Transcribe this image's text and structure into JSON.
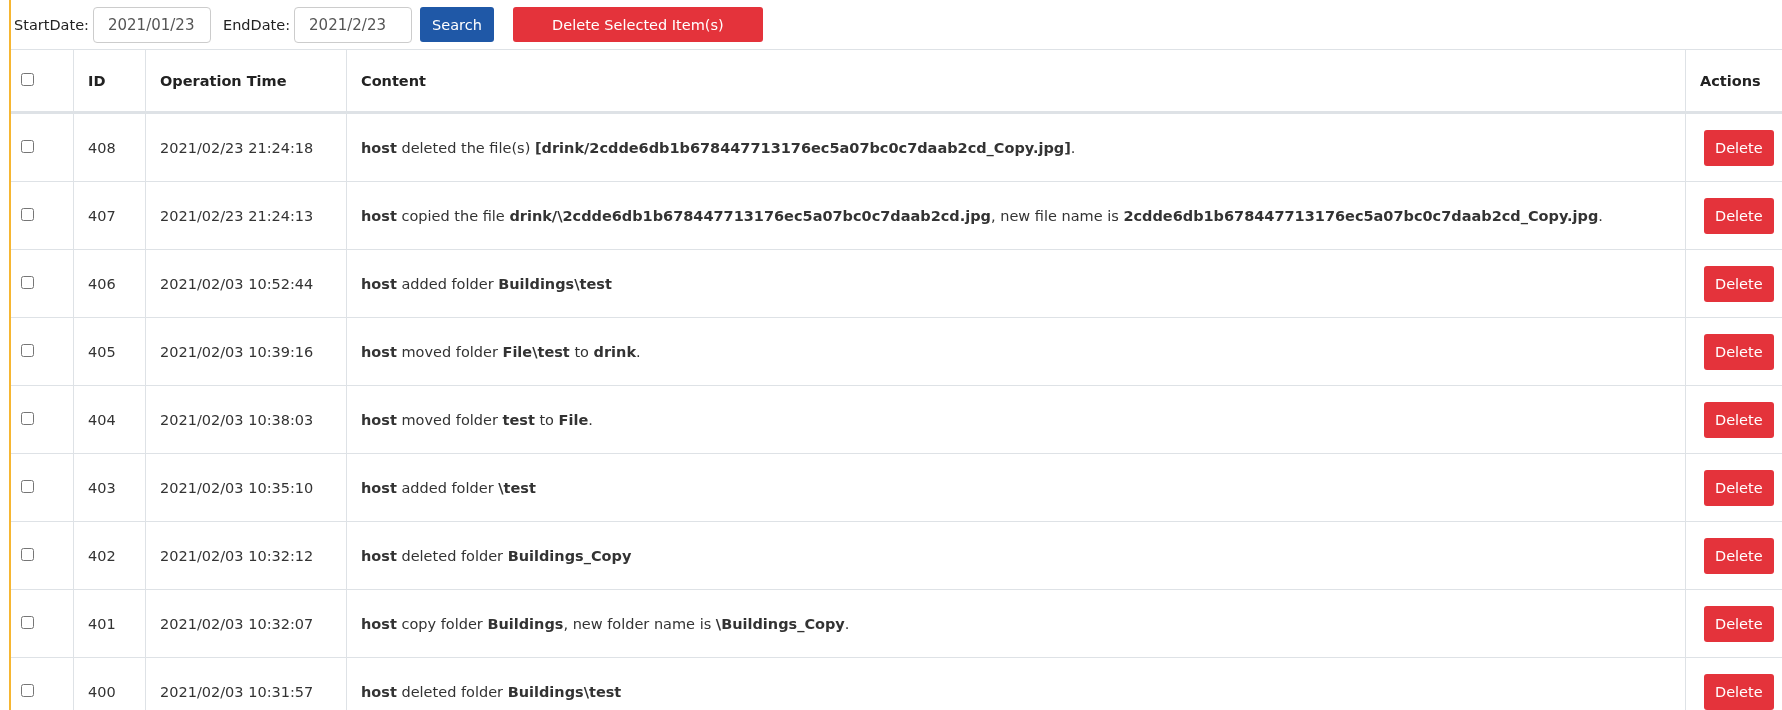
{
  "filter": {
    "start_label": "StartDate:",
    "start_value": "2021/01/23",
    "end_label": "EndDate:",
    "end_value": "2021/2/23",
    "search_button": "Search",
    "delete_selected_button": "Delete Selected Item(s)"
  },
  "table": {
    "select_all_checked": false,
    "columns": [
      "ID",
      "Operation Time",
      "Content",
      "Actions"
    ],
    "rows": [
      {
        "checked": false,
        "id": "408",
        "time": "2021/02/23 21:24:18",
        "content": "**host** deleted the file(s) **[drink/2cdde6db1b678447713176ec5a07bc0c7daab2cd_Copy.jpg]**.",
        "action": "Delete"
      },
      {
        "checked": false,
        "id": "407",
        "time": "2021/02/23 21:24:13",
        "content": "**host** copied the file **drink/\\2cdde6db1b678447713176ec5a07bc0c7daab2cd.jpg**, new file name is **2cdde6db1b678447713176ec5a07bc0c7daab2cd_Copy.jpg**.",
        "action": "Delete"
      },
      {
        "checked": false,
        "id": "406",
        "time": "2021/02/03 10:52:44",
        "content": "**host** added folder **Buildings\\test**",
        "action": "Delete"
      },
      {
        "checked": false,
        "id": "405",
        "time": "2021/02/03 10:39:16",
        "content": "**host** moved folder **File\\test** to **drink**.",
        "action": "Delete"
      },
      {
        "checked": false,
        "id": "404",
        "time": "2021/02/03 10:38:03",
        "content": "**host** moved folder **test** to **File**.",
        "action": "Delete"
      },
      {
        "checked": false,
        "id": "403",
        "time": "2021/02/03 10:35:10",
        "content": "**host** added folder **\\test**",
        "action": "Delete"
      },
      {
        "checked": false,
        "id": "402",
        "time": "2021/02/03 10:32:12",
        "content": "**host** deleted folder **Buildings_Copy**",
        "action": "Delete"
      },
      {
        "checked": false,
        "id": "401",
        "time": "2021/02/03 10:32:07",
        "content": "**host** copy folder **Buildings**, new folder name is **\\Buildings_Copy**.",
        "action": "Delete"
      },
      {
        "checked": false,
        "id": "400",
        "time": "2021/02/03 10:31:57",
        "content": "**host** deleted folder **Buildings\\test**",
        "action": "Delete"
      }
    ]
  }
}
